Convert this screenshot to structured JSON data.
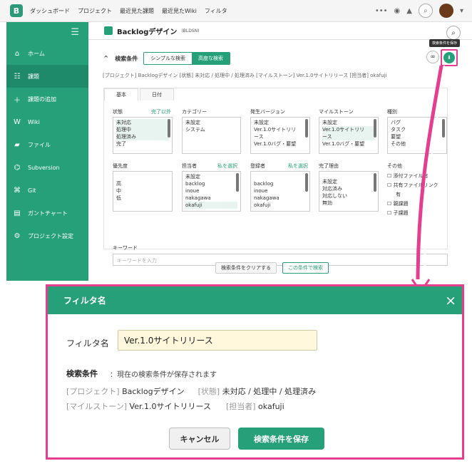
{
  "top": {
    "nav": [
      "ダッシュボード",
      "プロジェクト",
      "最近見た課題",
      "最近見たWiki",
      "フィルタ"
    ]
  },
  "project": {
    "name": "Backlogデザイン",
    "key": "(BLDSN)"
  },
  "sidebar": {
    "items": [
      {
        "label": "ホーム",
        "icon": "home-icon"
      },
      {
        "label": "課題",
        "icon": "list-icon"
      },
      {
        "label": "課題の追加",
        "icon": "plus-icon"
      },
      {
        "label": "Wiki",
        "icon": "wiki-icon"
      },
      {
        "label": "ファイル",
        "icon": "folder-icon"
      },
      {
        "label": "Subversion",
        "icon": "svn-icon"
      },
      {
        "label": "Git",
        "icon": "git-icon"
      },
      {
        "label": "ガントチャート",
        "icon": "gantt-icon"
      },
      {
        "label": "プロジェクト設定",
        "icon": "gear-icon"
      }
    ]
  },
  "search": {
    "title": "検索条件",
    "tab_simple": "シンプルな検索",
    "tab_advanced": "高度な検索",
    "tooltip": "検索条件を保存",
    "summary": "[プロジェクト] Backlogデザイン [状態] 未対応 / 処理中 / 処理済み [マイルストーン] Ver.1.0サイトリリース [担当者] okafuji",
    "inner_tabs": [
      "基本",
      "日付"
    ],
    "keyword_label": "キーワード",
    "keyword_placeholder": "キーワードを入力",
    "clear_button": "検索条件をクリアする",
    "search_button": "この条件で検索"
  },
  "fields": {
    "status": {
      "label": "状態",
      "action": "完了以外",
      "options": [
        "未対応",
        "処理中",
        "処理済み",
        "完了"
      ]
    },
    "category": {
      "label": "カテゴリー",
      "options": [
        "未設定",
        "システム"
      ]
    },
    "version": {
      "label": "発生バージョン",
      "options": [
        "未設定",
        "Ver.1.0サイトリリ",
        "ース",
        "Ver.1.0バグ・要望"
      ]
    },
    "milestone": {
      "label": "マイルストーン",
      "options": [
        "未設定",
        "Ver.1.0サイトリリ",
        "ース",
        "Ver.1.0バグ・要望"
      ]
    },
    "type": {
      "label": "種別",
      "options": [
        "バグ",
        "タスク",
        "要望",
        "その他"
      ]
    },
    "priority": {
      "label": "優先度",
      "options": [
        "高",
        "中",
        "低"
      ]
    },
    "assignee": {
      "label": "担当者",
      "action": "私を選択",
      "options": [
        "未設定",
        "backlog",
        "inoue",
        "nakagawa",
        "okafuji"
      ]
    },
    "creator": {
      "label": "登録者",
      "action": "私を選択",
      "options": [
        "backlog",
        "inoue",
        "nakagawa",
        "okafuji"
      ]
    },
    "resolution": {
      "label": "完了理由",
      "options": [
        "未設定",
        "対応済み",
        "対応しない",
        "無効"
      ]
    },
    "other": {
      "label": "その他",
      "options": [
        "添付ファイル有",
        "共有ファイルリンク",
        "有",
        "親課題",
        "子課題"
      ]
    }
  },
  "modal": {
    "title": "フィルタ名",
    "name_label": "フィルタ名",
    "name_value": "Ver.1.0サイトリリース",
    "cond_title": "検索条件",
    "cond_note": "：現在の検索条件が保存されます",
    "line1_label1": "[プロジェクト]",
    "line1_value1": "Backlogデザイン",
    "line1_label2": "[状態]",
    "line1_value2": "未対応 / 処理中 / 処理済み",
    "line2_label1": "[マイルストーン]",
    "line2_value1": "Ver.1.0サイトリリース",
    "line2_label2": "[担当者]",
    "line2_value2": "okafuji",
    "cancel": "キャンセル",
    "save": "検索条件を保存"
  }
}
